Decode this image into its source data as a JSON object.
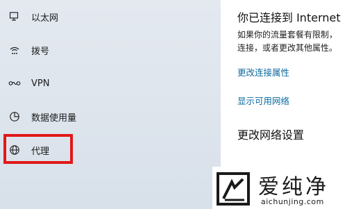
{
  "sidebar": {
    "items": [
      {
        "label": "以太网",
        "icon": "ethernet-icon"
      },
      {
        "label": "拨号",
        "icon": "dialup-icon"
      },
      {
        "label": "VPN",
        "icon": "vpn-icon"
      },
      {
        "label": "数据使用量",
        "icon": "data-usage-icon"
      },
      {
        "label": "代理",
        "icon": "globe-icon",
        "highlighted": true
      }
    ]
  },
  "content": {
    "heading": "你已连接到 Internet",
    "description_lines": [
      "如果你的流量套餐有限制，",
      "连接，或者更改其他属性。"
    ],
    "link_change_properties": "更改连接属性",
    "link_show_networks": "显示可用网络",
    "section_heading": "更改网络设置"
  },
  "watermark": {
    "text_cn": "爱纯净",
    "text_en": "aichunjing.com"
  },
  "colors": {
    "link": "#0a6a9e",
    "highlight_border": "#e01818",
    "sidebar_bg": "#dfe5ed"
  }
}
